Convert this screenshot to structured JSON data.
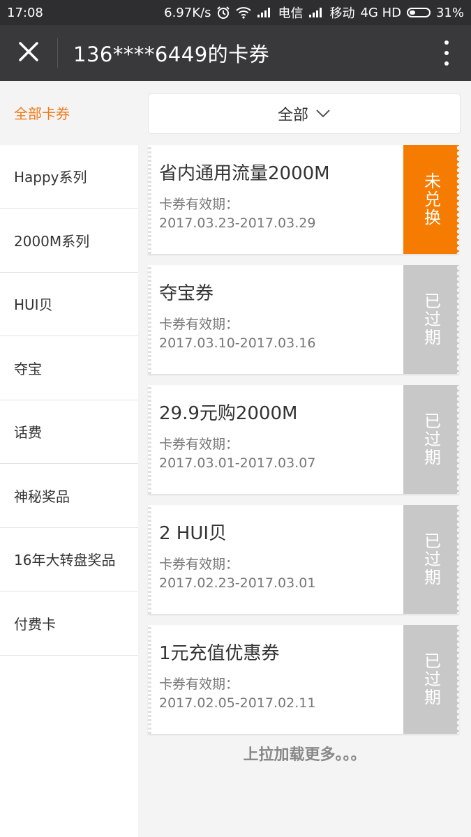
{
  "status_bar": {
    "time": "17:08",
    "speed": "6.97K/s",
    "carrier1": "电信",
    "carrier2": "移动",
    "network": "4G HD",
    "battery": "31%",
    "battery_level": 0.31
  },
  "header": {
    "title": "136****6449的卡券",
    "icons": {
      "close": "close-icon",
      "more": "more-vertical-icon"
    }
  },
  "sidebar": {
    "items": [
      {
        "label": "全部卡券"
      },
      {
        "label": "Happy系列"
      },
      {
        "label": "2000M系列"
      },
      {
        "label": "HUI贝"
      },
      {
        "label": "夺宝"
      },
      {
        "label": "话费"
      },
      {
        "label": "神秘奖品"
      },
      {
        "label": "16年大转盘奖品"
      },
      {
        "label": "付费卡"
      }
    ]
  },
  "filter": {
    "label": "全部",
    "icon": "chevron-down-icon"
  },
  "cards": [
    {
      "name": "省内通用流量2000M",
      "validity_label": "卡券有效期：",
      "validity": "2017.03.23-2017.03.29",
      "status": "未兑换"
    },
    {
      "name": "夺宝券",
      "validity_label": "卡券有效期：",
      "validity": "2017.03.10-2017.03.16",
      "status": "已过期"
    },
    {
      "name": "29.9元购2000M",
      "validity_label": "卡券有效期：",
      "validity": "2017.03.01-2017.03.07",
      "status": "已过期"
    },
    {
      "name": "2 HUI贝",
      "validity_label": "卡券有效期：",
      "validity": "2017.02.23-2017.03.01",
      "status": "已过期"
    },
    {
      "name": "1元充值优惠券",
      "validity_label": "卡券有效期：",
      "validity": "2017.02.05-2017.02.11",
      "status": "已过期"
    }
  ],
  "load_more": "上拉加载更多。。。",
  "colors": {
    "accent": "#f07c1c",
    "unredeemed": "#f57c00",
    "expired": "#c8c8c8",
    "header_bg": "#39393b"
  }
}
